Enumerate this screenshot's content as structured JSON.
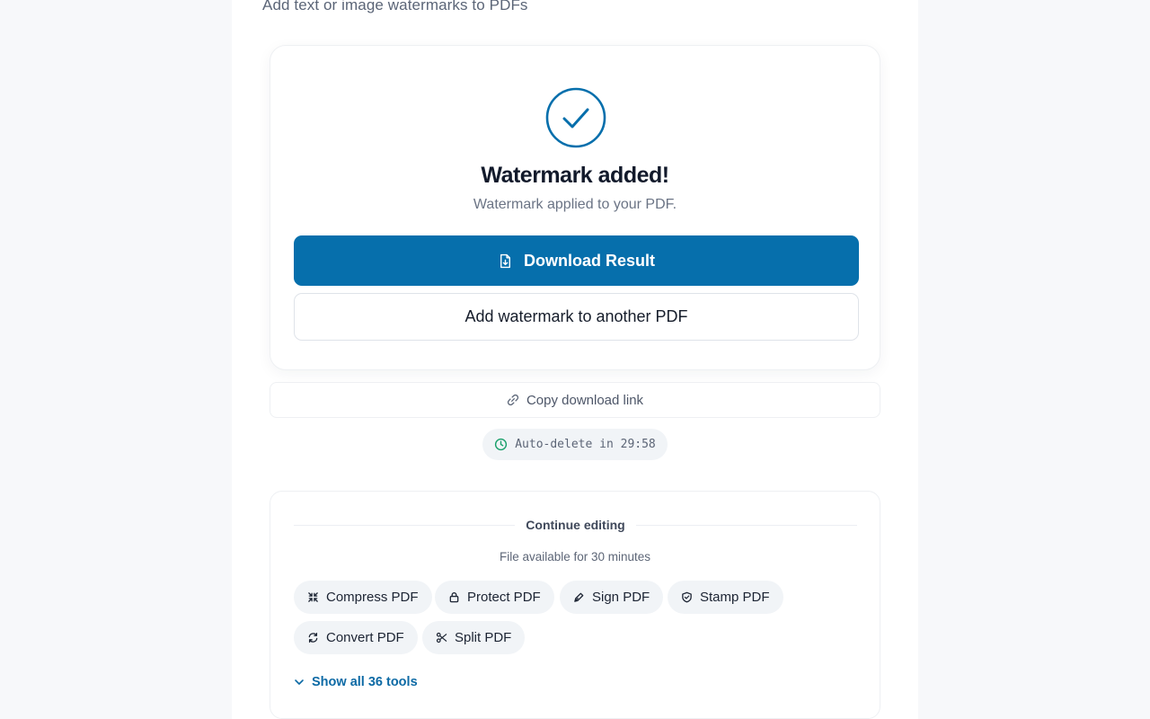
{
  "header": {
    "subtitle": "Add text or image watermarks to PDFs"
  },
  "result": {
    "icon": "check-circle-icon",
    "title": "Watermark added!",
    "description": "Watermark applied to your PDF.",
    "download_label": "Download Result",
    "another_label": "Add watermark to another PDF"
  },
  "copy_link": {
    "label": "Copy download link",
    "icon": "link-icon"
  },
  "autodelete": {
    "label": "Auto-delete in 29:58",
    "icon": "clock-icon"
  },
  "continue_editing": {
    "title": "Continue editing",
    "availability": "File available for 30 minutes",
    "tools": [
      {
        "label": "Compress PDF",
        "icon": "compress-icon"
      },
      {
        "label": "Protect PDF",
        "icon": "lock-icon"
      },
      {
        "label": "Sign PDF",
        "icon": "pen-icon"
      },
      {
        "label": "Stamp PDF",
        "icon": "shield-icon"
      },
      {
        "label": "Convert PDF",
        "icon": "refresh-icon"
      },
      {
        "label": "Split PDF",
        "icon": "scissors-icon"
      }
    ],
    "show_all_label": "Show all 36 tools"
  },
  "colors": {
    "accent": "#066fac",
    "link": "#0d6aa5",
    "success": "#1aa06b",
    "background": "#f7f8fa"
  }
}
